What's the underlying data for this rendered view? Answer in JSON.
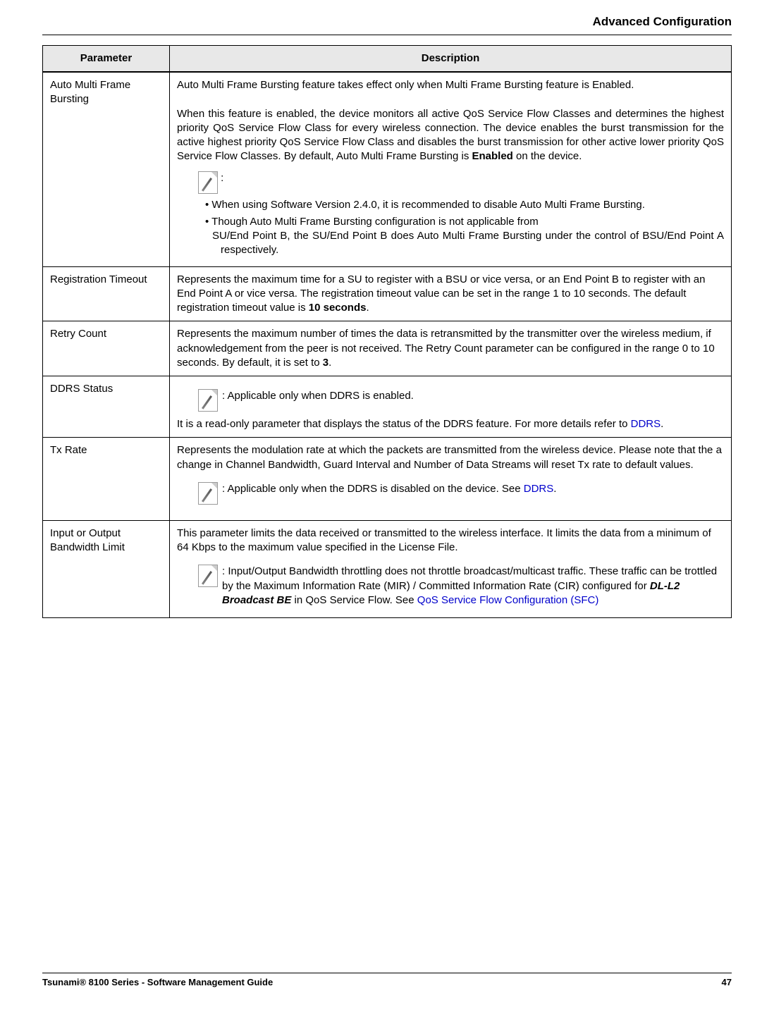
{
  "section_title": "Advanced Configuration",
  "table": {
    "headers": {
      "param": "Parameter",
      "desc": "Description"
    }
  },
  "rows": {
    "r1": {
      "param": "Auto Multi Frame Bursting",
      "p1": "Auto Multi Frame Bursting feature takes effect only when Multi Frame Bursting feature is Enabled.",
      "p2a": "When this feature is enabled, the device monitors all active QoS Service Flow Classes and determines the highest priority QoS Service Flow Class for every wireless connection. The device enables the burst transmission for the active highest priority QoS Service Flow Class and disables the burst transmission for other active lower priority QoS Service Flow Classes. By default, Auto Multi Frame Bursting is ",
      "p2b": "Enabled",
      "p2c": " on the device.",
      "note_colon": ":",
      "b1": "When using Software Version 2.4.0, it is recommended to disable Auto Multi Frame Bursting.",
      "b2": "Though Auto Multi Frame Bursting configuration is not applicable from",
      "b2sub": "SU/End Point B, the SU/End Point B does Auto Multi Frame Bursting under the control of BSU/End Point A respectively."
    },
    "r2": {
      "param": "Registration Timeout",
      "t1": "Represents the maximum time for a SU to register with a BSU or vice versa, or an End Point B to register with an End Point A or vice versa. The registration timeout value can be set in the range 1 to 10 seconds. The default registration timeout value is ",
      "t2": "10 seconds",
      "t3": "."
    },
    "r3": {
      "param": "Retry Count",
      "t1": "Represents the maximum number of times the data is retransmitted by the transmitter over the wireless medium, if acknowledgement from the peer is not received. The Retry Count parameter can be configured in the range 0 to 10 seconds. By default, it is set to ",
      "t2": "3",
      "t3": "."
    },
    "r4": {
      "param": "DDRS Status",
      "note": ": Applicable only when DDRS is enabled.",
      "t1": "It is a read-only parameter that displays the status of the DDRS feature. For more details refer to ",
      "link": "DDRS",
      "t2": "."
    },
    "r5": {
      "param": "Tx Rate",
      "t1": "Represents the modulation rate at which the packets are transmitted from the wireless device. Please note that the a change in Channel Bandwidth, Guard Interval and Number of Data Streams will reset Tx rate to default values.",
      "note1": ": Applicable only when the DDRS is disabled on the device. See ",
      "link": "DDRS",
      "note2": "."
    },
    "r6": {
      "param": "Input or Output Bandwidth Limit",
      "t1": "This parameter limits the data received or transmitted to the wireless interface. It limits the data from a minimum of 64 Kbps to the maximum value specified in the License File.",
      "note1": ": Input/Output Bandwidth throttling does not throttle broadcast/multicast traffic. These traffic can be trottled by the Maximum Information Rate (MIR) / Committed Information Rate (CIR) configured for ",
      "bi": "DL-L2 Broadcast BE",
      "note2": " in QoS Service Flow. See ",
      "link": "QoS Service Flow Configuration (SFC)"
    }
  },
  "footer": {
    "left": "Tsunami® 8100 Series - Software Management Guide",
    "right": "47"
  }
}
